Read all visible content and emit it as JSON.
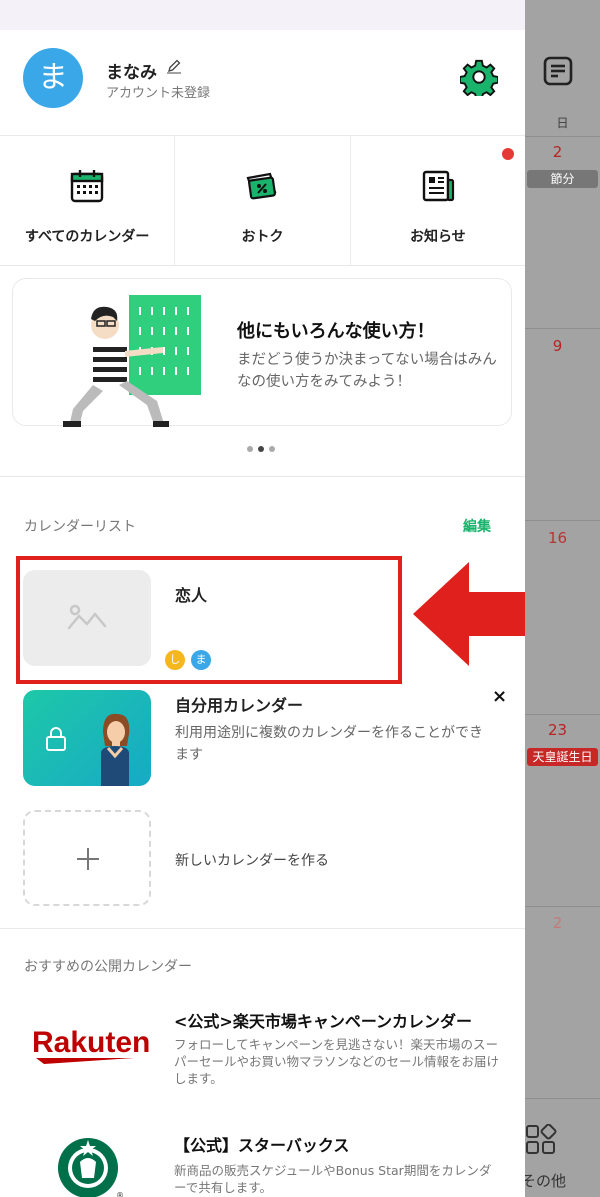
{
  "profile": {
    "avatar_letter": "ま",
    "name": "まなみ",
    "status": "アカウント未登録"
  },
  "quick_actions": [
    {
      "label": "すべてのカレンダー",
      "icon": "calendar-grid-icon"
    },
    {
      "label": "おトク",
      "icon": "coupon-ticket-icon"
    },
    {
      "label": "お知らせ",
      "icon": "newspaper-icon"
    }
  ],
  "banner": {
    "title": "他にもいろんな使い方！",
    "description": "まだどう使うか決まってない場合はみんなの使い方をみてみよう！",
    "page_dots": {
      "count": 3,
      "active": 2
    }
  },
  "calendar_list": {
    "section_title": "カレンダーリスト",
    "edit_label": "編集",
    "items": [
      {
        "name": "恋人",
        "members": [
          "し",
          "ま"
        ]
      },
      {
        "name": "自分用カレンダー",
        "description": "利用用途別に複数のカレンダーを作ることができます",
        "close_label": "×"
      }
    ],
    "new_calendar_label": "新しいカレンダーを作る"
  },
  "public_calendars": {
    "section_title": "おすすめの公開カレンダー",
    "items": [
      {
        "logo_text": "Rakuten",
        "name": "<公式>楽天市場キャンペーンカレンダー",
        "description": "フォローしてキャンペーンを見逃さない！楽天市場のスーパーセールやお買い物マラソンなどのセール情報をお届けします。"
      },
      {
        "logo_text": "®",
        "name": "【公式】スターバックス",
        "description": "新商品の販売スケジュールやBonus Star期間をカレンダーで共有します。"
      }
    ]
  },
  "background_calendar": {
    "weekday": "日",
    "days": [
      "2",
      "9",
      "16",
      "23",
      "2"
    ],
    "holidays": [
      "節分",
      "天皇誕生日"
    ],
    "other_label": "その他"
  },
  "colors": {
    "accent_green": "#19b36b",
    "avatar_blue": "#3aa8e8",
    "highlight_red": "#e0201c",
    "member_yellow": "#f4b71d"
  }
}
